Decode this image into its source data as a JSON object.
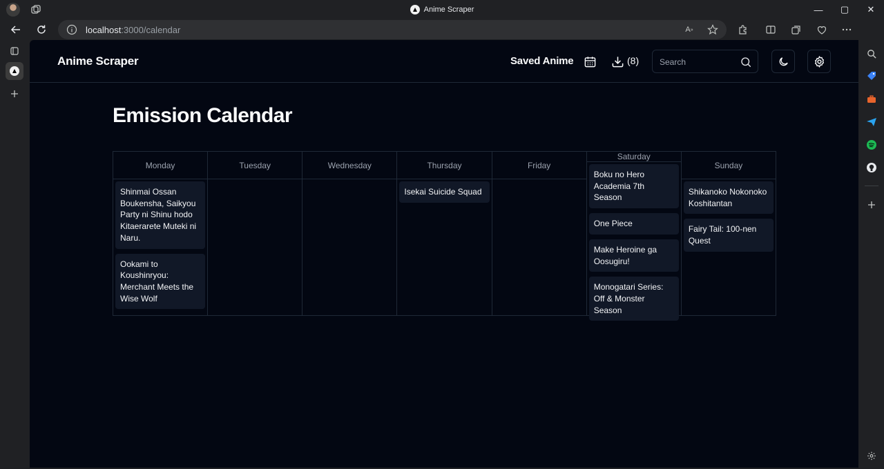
{
  "browser": {
    "tab_title": "Anime Scraper",
    "url_host": "localhost",
    "url_rest": ":3000/calendar",
    "window_controls": [
      "—",
      "▢",
      "✕"
    ]
  },
  "app": {
    "brand": "Anime Scraper",
    "nav": {
      "saved_label": "Saved Anime",
      "download_count": "(8)"
    },
    "search": {
      "placeholder": "Search"
    },
    "page_title": "Emission Calendar"
  },
  "calendar": {
    "days": [
      {
        "name": "Monday",
        "anime": [
          "Shinmai Ossan Boukensha, Saikyou Party ni Shinu hodo Kitaerarete Muteki ni Naru.",
          "Ookami to Koushinryou: Merchant Meets the Wise Wolf"
        ]
      },
      {
        "name": "Tuesday",
        "anime": []
      },
      {
        "name": "Wednesday",
        "anime": []
      },
      {
        "name": "Thursday",
        "anime": [
          "Isekai Suicide Squad"
        ]
      },
      {
        "name": "Friday",
        "anime": []
      },
      {
        "name": "Saturday",
        "anime": [
          "Boku no Hero Academia 7th Season",
          "One Piece",
          "Make Heroine ga Oosugiru!",
          "Monogatari Series: Off & Monster Season"
        ]
      },
      {
        "name": "Sunday",
        "anime": [
          "Shikanoko Nokonoko Koshitantan",
          "Fairy Tail: 100-nen Quest"
        ]
      }
    ]
  },
  "colors": {
    "app_bg": "#030712",
    "card_bg": "#111827",
    "border": "#1f2937",
    "chrome_bg": "#202124"
  }
}
